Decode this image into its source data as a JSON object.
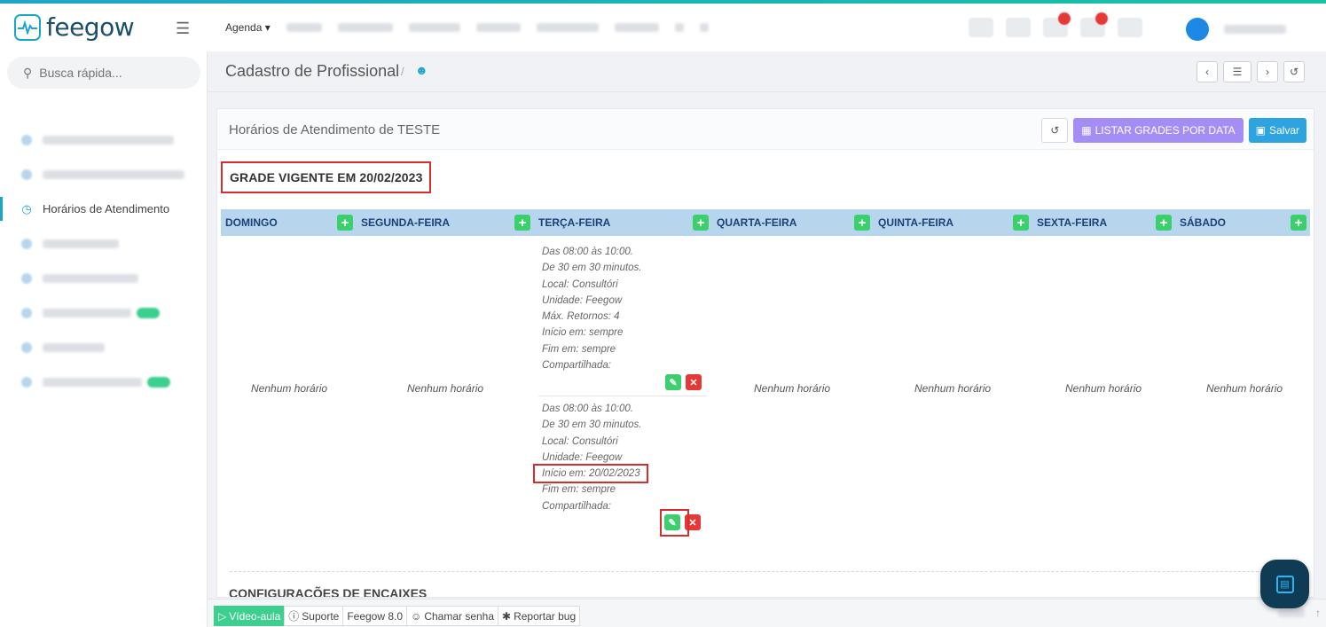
{
  "header": {
    "logo_text": "feegow",
    "nav": {
      "agenda_label": "Agenda"
    }
  },
  "sidebar": {
    "search_placeholder": "Busca rápida...",
    "active_item_label": "Horários de Atendimento"
  },
  "breadcrumb": {
    "title": "Cadastro de Profissional",
    "separator": "/"
  },
  "panel": {
    "title": "Horários de Atendimento de TESTE",
    "list_button_label": "LISTAR GRADES POR DATA",
    "save_button_label": "Salvar",
    "grade_title": "GRADE VIGENTE EM 20/02/2023",
    "config_title": "CONFIGURAÇÕES DE ENCAIXES",
    "days": [
      {
        "label": "DOMINGO",
        "empty_text": "Nenhum horário"
      },
      {
        "label": "SEGUNDA-FEIRA",
        "empty_text": "Nenhum horário"
      },
      {
        "label": "TERÇA-FEIRA",
        "empty_text": ""
      },
      {
        "label": "QUARTA-FEIRA",
        "empty_text": "Nenhum horário"
      },
      {
        "label": "QUINTA-FEIRA",
        "empty_text": "Nenhum horário"
      },
      {
        "label": "SEXTA-FEIRA",
        "empty_text": "Nenhum horário"
      },
      {
        "label": "SÁBADO",
        "empty_text": "Nenhum horário"
      }
    ],
    "tuesday_slots": [
      {
        "lines": [
          "Das 08:00 às 10:00.",
          "De 30 em 30 minutos.",
          "Local: Consultóri",
          "Unidade: Feegow",
          "Máx. Retornos: 4",
          "Início em: sempre",
          "Fim em: sempre",
          "Compartilhada:"
        ]
      },
      {
        "lines": [
          "Das 08:00 às 10:00.",
          "De 30 em 30 minutos.",
          "Local: Consultóri",
          "Unidade: Feegow",
          "Início em: 20/02/2023",
          "Fim em: sempre",
          "Compartilhada:"
        ]
      }
    ]
  },
  "footer": {
    "video_label": "Vídeo-aula",
    "support_label": "Suporte",
    "version_label": "Feegow 8.0",
    "call_label": "Chamar senha",
    "bug_label": "Reportar bug"
  }
}
